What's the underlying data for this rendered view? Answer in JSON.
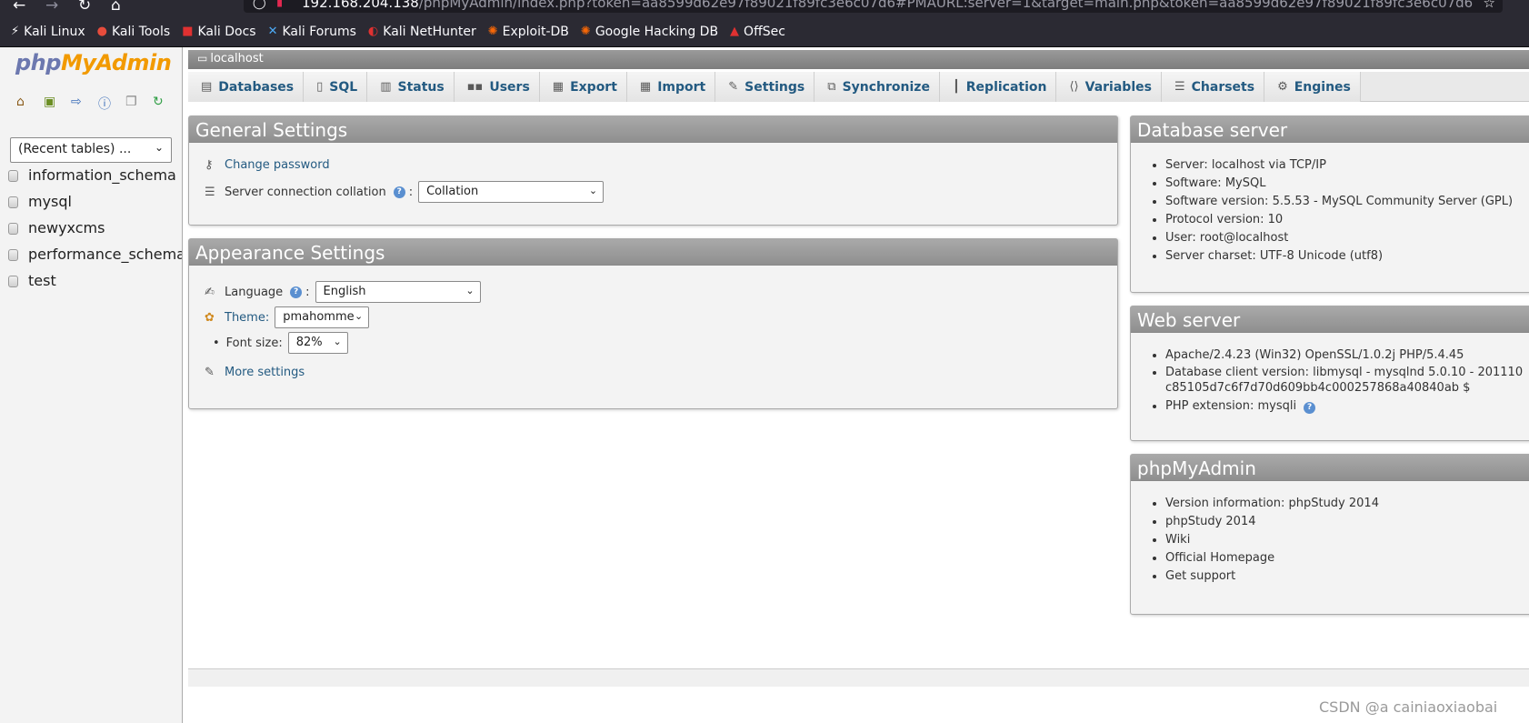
{
  "browser": {
    "url_host": "192.168.204.138",
    "url_rest": "/phpMyAdmin/index.php?token=aa8599d62e97f89021f89fc3e6c07d6#PMAURL:server=1&target=main.php&token=aa8599d62e97f89021f89fc3e6c07d6",
    "bookmarks": [
      "Kali Linux",
      "Kali Tools",
      "Kali Docs",
      "Kali Forums",
      "Kali NetHunter",
      "Exploit-DB",
      "Google Hacking DB",
      "OffSec"
    ]
  },
  "nav": {
    "logo_php": "php",
    "logo_myadmin": "MyAdmin",
    "recent_tables": "(Recent tables) ...",
    "databases": [
      "information_schema",
      "mysql",
      "newyxcms",
      "performance_schema",
      "test"
    ]
  },
  "serverbar": {
    "label": "localhost"
  },
  "tabs": [
    "Databases",
    "SQL",
    "Status",
    "Users",
    "Export",
    "Import",
    "Settings",
    "Synchronize",
    "Replication",
    "Variables",
    "Charsets",
    "Engines"
  ],
  "general": {
    "title": "General Settings",
    "change_password": "Change password",
    "collation_label": "Server connection collation",
    "collation_value": "Collation"
  },
  "appearance": {
    "title": "Appearance Settings",
    "language_label": "Language",
    "language_value": "English",
    "theme_label": "Theme:",
    "theme_value": "pmahomme",
    "fontsize_label": "Font size:",
    "fontsize_value": "82%",
    "more_settings": "More settings"
  },
  "db_server": {
    "title": "Database server",
    "items": [
      "Server: localhost via TCP/IP",
      "Software: MySQL",
      "Software version: 5.5.53 - MySQL Community Server (GPL)",
      "Protocol version: 10",
      "User: root@localhost",
      "Server charset: UTF-8 Unicode (utf8)"
    ]
  },
  "web_server": {
    "title": "Web server",
    "apache": "Apache/2.4.23 (Win32) OpenSSL/1.0.2j PHP/5.4.45",
    "client_line1": "Database client version: libmysql - mysqlnd 5.0.10 - 201110",
    "client_line2": "c85105d7c6f7d70d609bb4c000257868a40840ab $",
    "php_ext": "PHP extension: mysqli"
  },
  "pma_info": {
    "title": "phpMyAdmin",
    "version": "Version information: phpStudy 2014",
    "links": [
      "phpStudy 2014",
      "Wiki",
      "Official Homepage",
      "Get support"
    ]
  },
  "watermark": "CSDN @a cainiaoxiaobai"
}
